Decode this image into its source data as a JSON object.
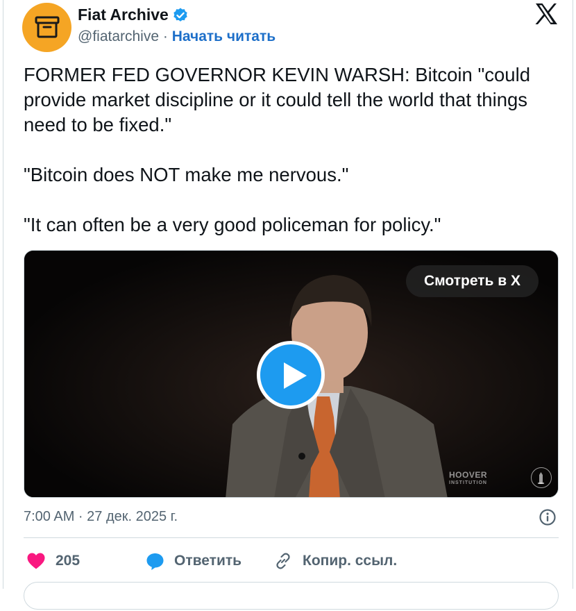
{
  "author": {
    "name": "Fiat Archive",
    "handle": "@fiatarchive",
    "separator": " · ",
    "follow_label": "Начать читать",
    "avatar_icon": "archive-box-icon",
    "verified_icon": "verified-badge-icon"
  },
  "header": {
    "logo_icon": "x-logo-icon"
  },
  "tweet": {
    "paragraphs": [
      "FORMER FED GOVERNOR KEVIN WARSH: Bitcoin \"could provide market discipline or it could tell the world that things need to be fixed.\"",
      "\"Bitcoin does NOT make me nervous.\"",
      "\"It can often be a very good policeman for policy.\""
    ]
  },
  "media": {
    "watch_label": "Смотреть в X",
    "play_icon": "play-icon",
    "watermark_line1": "HOOVER",
    "watermark_line2": "INSTITUTION",
    "watermark_icon": "hoover-tower-icon"
  },
  "meta": {
    "timestamp": "7:00 AM · 27 дек. 2025 г.",
    "info_icon": "info-icon"
  },
  "actions": {
    "like_count": "205",
    "reply_label": "Ответить",
    "copy_link_label": "Копир. ссыл.",
    "like_icon": "heart-icon",
    "reply_icon": "reply-bubble-icon",
    "copy_icon": "link-icon"
  },
  "colors": {
    "accent": "#1d9bf0",
    "link": "#1d6fc9",
    "avatar": "#f5a524",
    "like": "#f91880",
    "text": "#0f1419",
    "muted": "#536471"
  }
}
